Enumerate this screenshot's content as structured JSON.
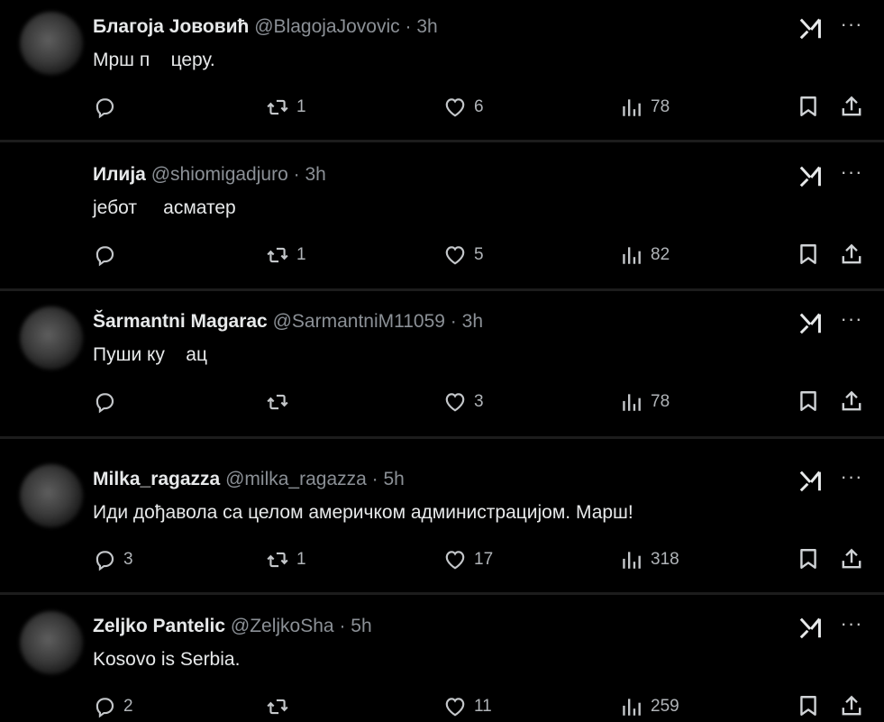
{
  "posts": [
    {
      "name": "Благоја Јововић",
      "handle": "@BlagojaJovovic",
      "dot": "·",
      "time": "3h",
      "text": "Мрш п    церу.",
      "replies": "",
      "reposts": "1",
      "likes": "6",
      "views": "78",
      "has_avatar": true
    },
    {
      "name": "Илија",
      "handle": "@shiomigadjuro",
      "dot": "·",
      "time": "3h",
      "text": "јебот     асматер",
      "replies": "",
      "reposts": "1",
      "likes": "5",
      "views": "82",
      "has_avatar": false
    },
    {
      "name": "Šarmantni Magarac",
      "handle": "@SarmantniM11059",
      "dot": "·",
      "time": "3h",
      "text": "Пуши ку    ац",
      "replies": "",
      "reposts": "",
      "likes": "3",
      "views": "78",
      "has_avatar": true
    },
    {
      "name": "Milka_ragazza",
      "handle": "@milka_ragazza",
      "dot": "·",
      "time": "5h",
      "text": "Иди дођавола са целом америчком администрацијом. Марш!",
      "replies": "3",
      "reposts": "1",
      "likes": "17",
      "views": "318",
      "has_avatar": true
    },
    {
      "name": "Zeljko Pantelic",
      "handle": "@ZeljkoSha",
      "dot": "·",
      "time": "5h",
      "text": "Kosovo is Serbia.",
      "replies": "2",
      "reposts": "",
      "likes": "11",
      "views": "259",
      "has_avatar": true
    }
  ],
  "icons": {
    "more": "···",
    "grok": "grok-icon",
    "reply": "reply-icon",
    "repost": "repost-icon",
    "like": "heart-icon",
    "views": "views-icon",
    "bookmark": "bookmark-icon",
    "share": "share-icon"
  },
  "colors": {
    "background": "#000000",
    "text": "#e7e9ea",
    "muted": "#8b9096",
    "separator": "#1c1c1c"
  }
}
